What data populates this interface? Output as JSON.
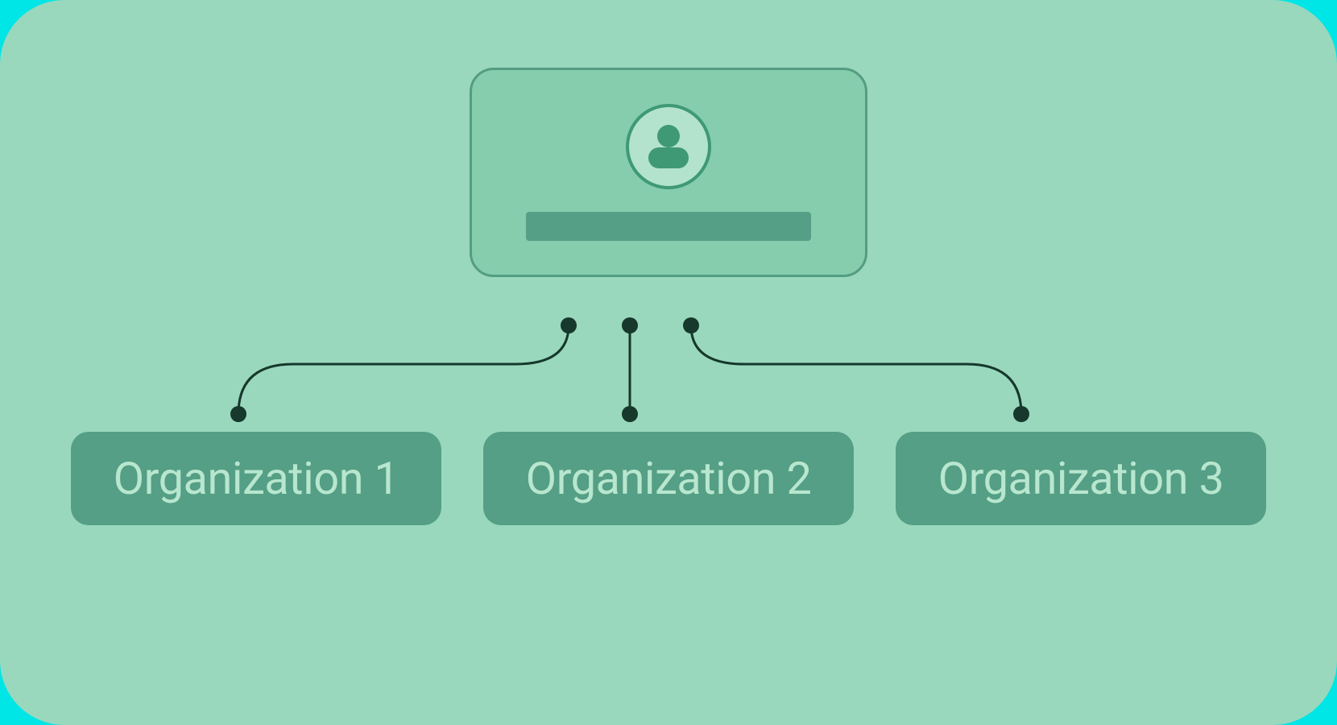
{
  "diagram": {
    "user_node": {
      "icon": "person-icon",
      "label_placeholder": ""
    },
    "organizations": [
      {
        "label": "Organization 1"
      },
      {
        "label": "Organization 2"
      },
      {
        "label": "Organization 3"
      }
    ]
  },
  "colors": {
    "background_accent": "#00e5e5",
    "panel": "#99d8bd",
    "card_fill": "#85cdad",
    "card_border": "#549c82",
    "avatar_bg": "#b3e3cd",
    "avatar_fg": "#3f9974",
    "pill_fill": "#549f85",
    "pill_text": "#b8e6ce",
    "connector": "#17382c"
  }
}
